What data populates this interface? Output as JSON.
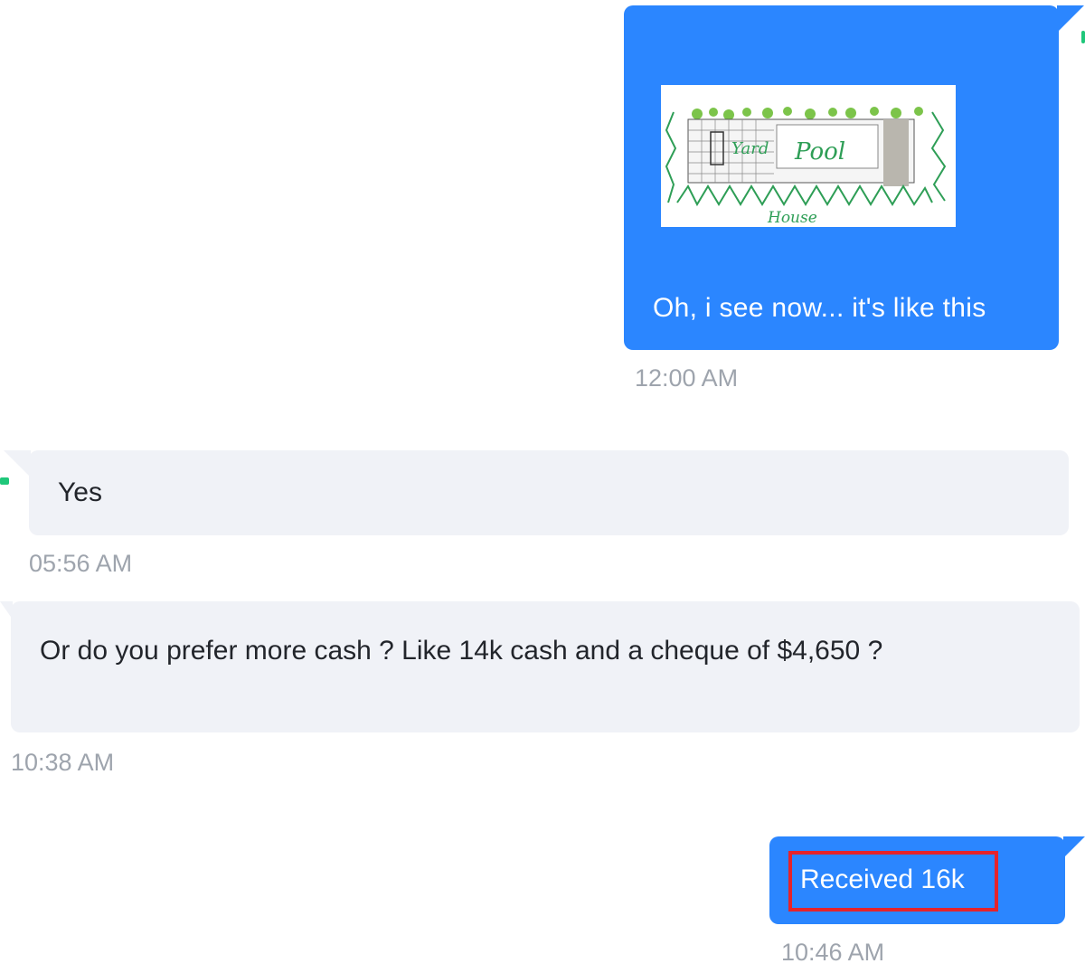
{
  "conversation": {
    "messages": [
      {
        "direction": "outgoing",
        "attachment": {
          "type": "image",
          "description_icon": "pool-sketch-image",
          "labels": [
            "Pool",
            "House",
            "Yard"
          ]
        },
        "text": "Oh, i see now...  it's like this",
        "time": "12:00 AM"
      },
      {
        "direction": "incoming",
        "text": "Yes",
        "time": "05:56 AM"
      },
      {
        "direction": "incoming",
        "text": "Or do you prefer more cash ? Like 14k cash and a cheque of $4,650 ?",
        "time": "10:38 AM"
      },
      {
        "direction": "outgoing",
        "text": "Received 16k",
        "time": "10:46 AM",
        "highlighted": true
      }
    ]
  },
  "colors": {
    "outgoing_bubble": "#2b86ff",
    "incoming_bubble": "#f0f2f7",
    "timestamp": "#9ea4ad",
    "highlight_border": "#e5232c",
    "status_mark": "#1fc77a"
  }
}
